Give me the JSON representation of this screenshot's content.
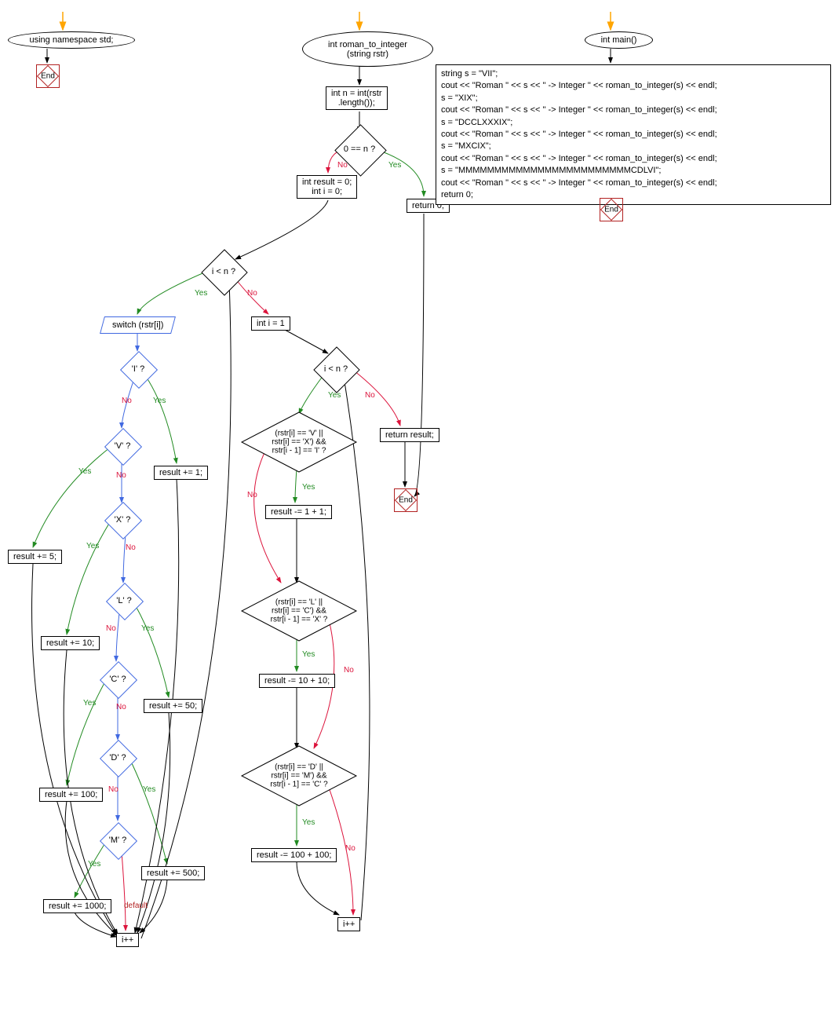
{
  "nodes": {
    "using_namespace": "using namespace std;",
    "roman_func": "int roman_to_integer\n(string rstr)",
    "main": "int main()",
    "int_n": "int n = int(rstr\n.length());",
    "n_eq_0": "0 == n ?",
    "result_init": "int result = 0;\nint i = 0;",
    "return_0": "return 0;",
    "i_lt_n_1": "i < n ?",
    "int_i_1": "int i = 1",
    "switch": "switch (rstr[i])",
    "case_i": "'I' ?",
    "case_v": "'V' ?",
    "case_x": "'X' ?",
    "case_l": "'L' ?",
    "case_c": "'C' ?",
    "case_d": "'D' ?",
    "case_m": "'M' ?",
    "res_1": "result += 1;",
    "res_5": "result += 5;",
    "res_10": "result += 10;",
    "res_50": "result += 50;",
    "res_100": "result += 100;",
    "res_500": "result += 500;",
    "res_1000": "result += 1000;",
    "i_inc_1": "i++",
    "i_lt_n_2": "i < n ?",
    "return_result": "return result;",
    "cond_vx": "(rstr[i] == 'V' ||\nrstr[i] == 'X') &&\nrstr[i - 1] == 'I' ?",
    "res_sub_2": "result -= 1 + 1;",
    "cond_lc": "(rstr[i] == 'L' ||\nrstr[i] == 'C') &&\nrstr[i - 1] == 'X' ?",
    "res_sub_20": "result -= 10 + 10;",
    "cond_dm": "(rstr[i] == 'D' ||\nrstr[i] == 'M') &&\nrstr[i - 1] == 'C' ?",
    "res_sub_200": "result -= 100 + 100;",
    "i_inc_2": "i++",
    "end": "End",
    "main_code": "string s = \"VII\";\ncout << \"Roman \" << s << \" -> Integer \" << roman_to_integer(s) << endl;\ns = \"XIX\";\ncout << \"Roman \" << s << \" -> Integer \" << roman_to_integer(s) << endl;\ns = \"DCCLXXXIX\";\ncout << \"Roman \" << s << \" -> Integer \" << roman_to_integer(s) << endl;\ns = \"MXCIX\";\ncout << \"Roman \" << s << \" -> Integer \" << roman_to_integer(s) << endl;\ns = \"MMMMMMMMMMMMMMMMMMMMMMMMCDLVI\";\ncout << \"Roman \" << s << \" -> Integer \" << roman_to_integer(s) << endl;\nreturn 0;"
  },
  "labels": {
    "yes": "Yes",
    "no": "No",
    "default": "default"
  }
}
